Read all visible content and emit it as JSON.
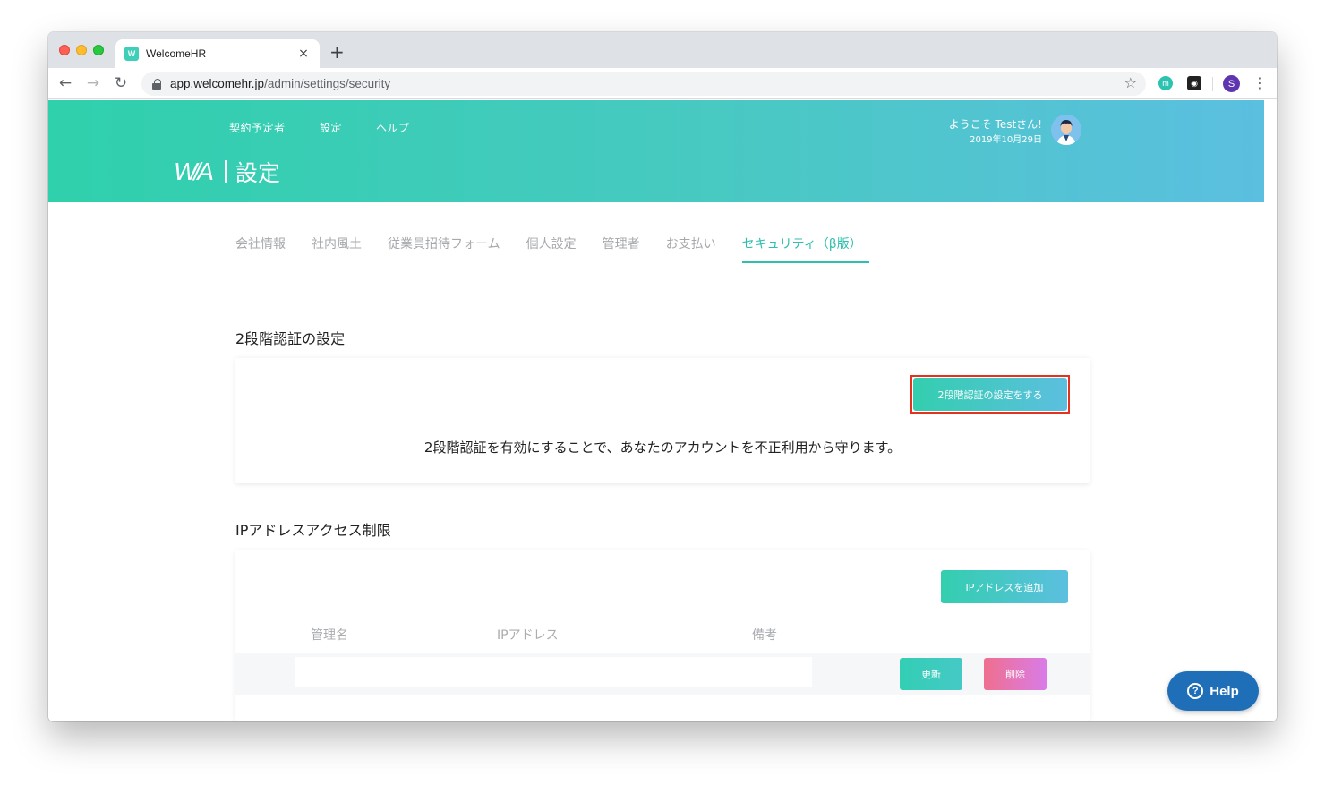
{
  "browser": {
    "tab_title": "WelcomeHR",
    "tab_favicon_text": "W",
    "url_host": "app.welcomehr.jp",
    "url_path": "/admin/settings/security",
    "profile_initial": "S",
    "ext_m_initial": "m"
  },
  "header": {
    "nav": [
      "契約予定者",
      "設定",
      "ヘルプ"
    ],
    "logo_text": "W/A",
    "page_title": "設定",
    "welcome": "ようこそ Testさん!",
    "date": "2019年10月29日",
    "colors": {
      "gradient_start": "#2fd0ac",
      "gradient_end": "#5bbfe0"
    }
  },
  "settings_tabs": [
    {
      "label": "会社情報",
      "active": false
    },
    {
      "label": "社内風土",
      "active": false
    },
    {
      "label": "従業員招待フォーム",
      "active": false
    },
    {
      "label": "個人設定",
      "active": false
    },
    {
      "label": "管理者",
      "active": false
    },
    {
      "label": "お支払い",
      "active": false
    },
    {
      "label": "セキュリティ（β版）",
      "active": true
    }
  ],
  "two_factor": {
    "section_title": "2段階認証の設定",
    "button_label": "2段階認証の設定をする",
    "description": "2段階認証を有効にすることで、あなたのアカウントを不正利用から守ります。"
  },
  "ip_restriction": {
    "section_title": "IPアドレスアクセス制限",
    "add_button_label": "IPアドレスを追加",
    "columns": [
      "管理名",
      "IPアドレス",
      "備考"
    ],
    "row": {
      "update_label": "更新",
      "delete_label": "削除"
    }
  },
  "help_button": {
    "label": "Help",
    "icon": "?"
  }
}
